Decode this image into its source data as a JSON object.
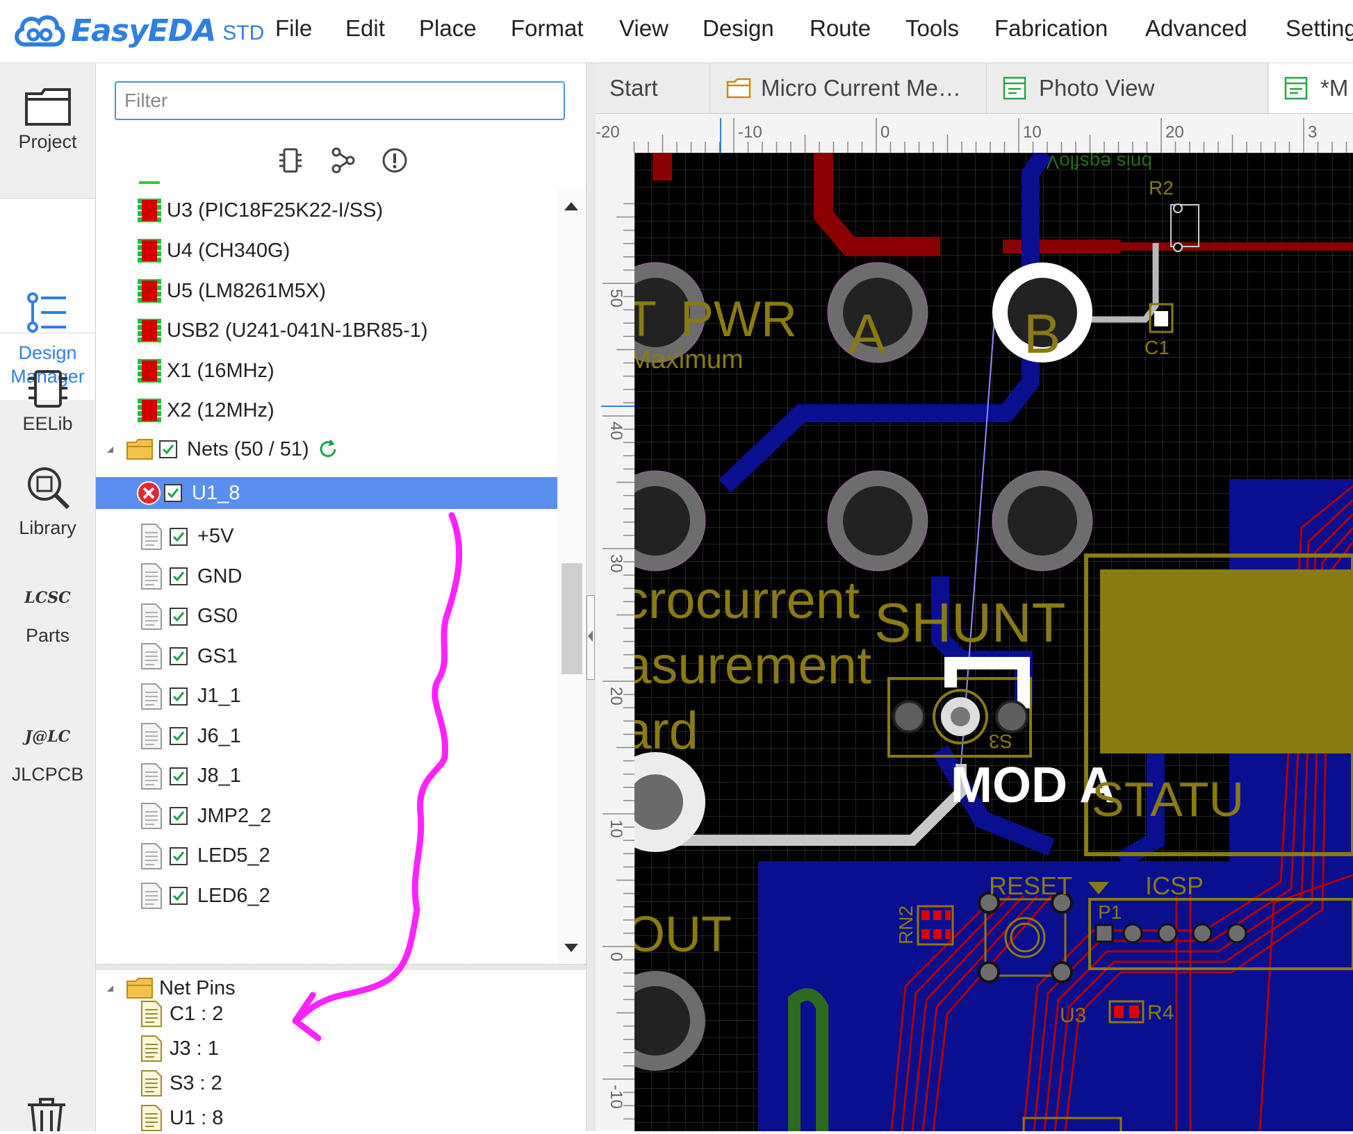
{
  "app": {
    "logo_text": "EasyEDA",
    "logo_sub": "STD",
    "brand_color": "#2f7fe0"
  },
  "menu": [
    "File",
    "Edit",
    "Place",
    "Format",
    "View",
    "Design",
    "Route",
    "Tools",
    "Fabrication",
    "Advanced",
    "Setting"
  ],
  "sidebar": {
    "items": [
      {
        "label": "Project",
        "icon": "folder-icon"
      },
      {
        "label": "Design Manager",
        "icon": "design-manager-icon",
        "active": true
      },
      {
        "label": "EELib",
        "icon": "chip-icon"
      },
      {
        "label": "Library",
        "icon": "library-search-icon"
      },
      {
        "label": "Parts",
        "icon": "lcsc-icon",
        "badge": "LCSC"
      },
      {
        "label": "JLCPCB",
        "icon": "jlc-icon",
        "badge": "J@LC"
      }
    ]
  },
  "filter": {
    "placeholder": "Filter",
    "value": ""
  },
  "tree": {
    "components": [
      "U3 (PIC18F25K22-I/SS)",
      "U4 (CH340G)",
      "U5 (LM8261M5X)",
      "USB2 (U241-041N-1BR85-1)",
      "X1 (16MHz)",
      "X2 (12MHz)"
    ],
    "nets_label": "Nets (50 / 51)",
    "nets": [
      "U1_8",
      "+5V",
      "GND",
      "GS0",
      "GS1",
      "J1_1",
      "J6_1",
      "J8_1",
      "JMP2_2",
      "LED5_2",
      "LED6_2"
    ],
    "selected_net": "U1_8",
    "net_pins_label": "Net Pins",
    "net_pins": [
      "C1 : 2",
      "J3 : 1",
      "S3 : 2",
      "U1 : 8"
    ]
  },
  "tabs": [
    {
      "label": "Start"
    },
    {
      "label": "Micro Current Me…",
      "icon": "folder-icon"
    },
    {
      "label": "Photo View",
      "icon": "photo-view-icon"
    },
    {
      "label": "*M",
      "icon": "pcb-icon"
    }
  ],
  "ruler": {
    "top_labels": [
      "-20",
      "-10",
      "0",
      "10",
      "20",
      "3"
    ],
    "left_labels": [
      "50",
      "40",
      "30",
      "20",
      "10",
      "0",
      "-10"
    ]
  },
  "pcb": {
    "silk_pwr": "PWR",
    "silk_maximum": "Maximum",
    "silk_t": "T",
    "silk_a": "A",
    "silk_b": "B",
    "silk_shunt": "SHUNT",
    "silk_mod_a": "MOD A",
    "silk_line1": "crocurrent",
    "silk_line2": "asurement",
    "silk_line3": "ard",
    "silk_out": "OUT",
    "silk_status": "STATU",
    "silk_reset": "RESET",
    "silk_icsp": "ICSP",
    "silk_p1": "P1",
    "silk_rn2": "RN2",
    "silk_u3": "U3",
    "silk_r4": "R4",
    "silk_r2": "R2",
    "silk_c1": "C1",
    "silk_s3": "S3",
    "silk_mirror_top": "bnis egsfloV",
    "colors": {
      "board": "#000000",
      "bottom_copper": "#0a0f8f",
      "top_copper": "#8a0000",
      "silk": "#8a7a12",
      "pad": "#5e5e5e",
      "annotation": "#ff22ff"
    }
  }
}
